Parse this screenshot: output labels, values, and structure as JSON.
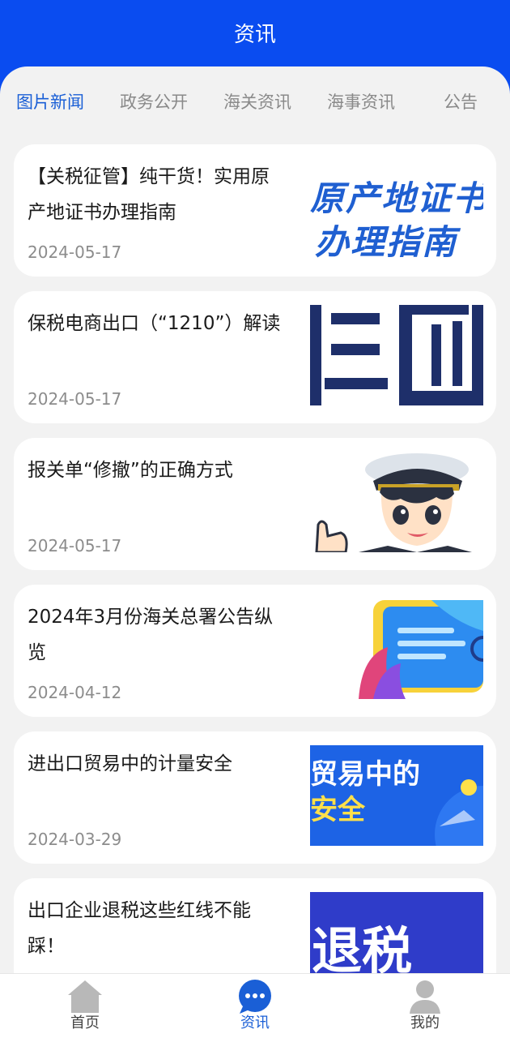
{
  "header": {
    "title": "资讯"
  },
  "tabs": [
    {
      "label": "图片新闻",
      "active": true
    },
    {
      "label": "政务公开",
      "active": false
    },
    {
      "label": "海关资讯",
      "active": false
    },
    {
      "label": "海事资讯",
      "active": false
    },
    {
      "label": "公告",
      "active": false
    }
  ],
  "articles": [
    {
      "title": "【关税征管】纯干货！实用原产地证书办理指南",
      "date": "2024-05-17",
      "thumb_text": [
        "原产地证书",
        "办理指南"
      ]
    },
    {
      "title": "保税电商出口（“1210”）解读",
      "date": "2024-05-17"
    },
    {
      "title": "报关单“修撤”的正确方式",
      "date": "2024-05-17"
    },
    {
      "title": "2024年3月份海关总署公告纵览",
      "date": "2024-04-12"
    },
    {
      "title": "进出口贸易中的计量安全",
      "date": "2024-03-29",
      "thumb_text": [
        "贸易中的",
        "安全"
      ]
    },
    {
      "title": "出口企业退税这些红线不能踩！",
      "date": "",
      "thumb_text": [
        "退税"
      ]
    }
  ],
  "bottom_nav": [
    {
      "label": "首页",
      "icon": "home-icon",
      "active": false
    },
    {
      "label": "资讯",
      "icon": "chat-bubble-icon",
      "active": true
    },
    {
      "label": "我的",
      "icon": "user-icon",
      "active": false
    }
  ],
  "colors": {
    "brand_blue": "#0a4cf0",
    "active_tab": "#1a5fd6",
    "background": "#f2f2f2"
  }
}
